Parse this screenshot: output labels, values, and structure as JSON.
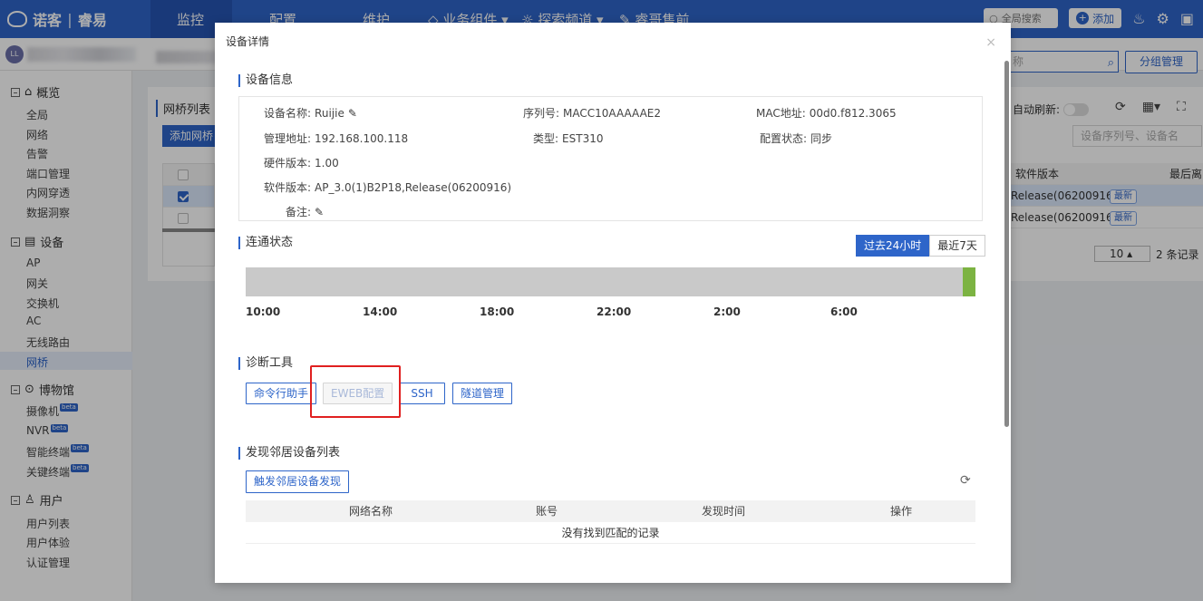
{
  "topbar": {
    "brand": "诺客",
    "brand2": "睿易",
    "nav": [
      "监控",
      "配置",
      "维护",
      "业务组件 ▾",
      "探索频道 ▾",
      "睿哥售前"
    ],
    "search_label": "全局搜索",
    "add_label": "添加"
  },
  "subbar": {
    "avatar_text": "LL"
  },
  "sidebar": {
    "groups": [
      {
        "label": "概览",
        "items": [
          "全局",
          "网络",
          "告警",
          "端口管理",
          "内网穿透",
          "数据洞察"
        ]
      },
      {
        "label": "设备",
        "items": [
          "AP",
          "网关",
          "交换机",
          "AC",
          "无线路由",
          "网桥"
        ]
      },
      {
        "label": "博物馆",
        "items": [
          "摄像机",
          "NVR",
          "智能终端",
          "关键终端"
        ]
      },
      {
        "label": "用户",
        "items": [
          "用户列表",
          "用户体验",
          "认证管理"
        ]
      }
    ],
    "beta": "beta",
    "active_item": "网桥"
  },
  "main": {
    "panel_title": "网桥列表",
    "add_button": "添加网桥",
    "search_placeholder": "称",
    "group_manage": "分组管理",
    "auto_refresh": "自动刷新:",
    "device_search_placeholder": "设备序列号、设备名",
    "col_software": "软件版本",
    "col_last": "最后离",
    "rows": [
      {
        "software": "Release(06200916)",
        "tag": "最新"
      },
      {
        "software": "Release(06200916)",
        "tag": "最新"
      }
    ],
    "page_size": "10",
    "record_count": "2 条记录"
  },
  "modal": {
    "title": "设备详情",
    "close": "×",
    "device_info": {
      "section": "设备信息",
      "name_label": "设备名称:",
      "name_value": "Ruijie",
      "serial_label": "序列号:",
      "serial_value": "MACC10AAAAAE2",
      "mac_label": "MAC地址:",
      "mac_value": "00d0.f812.3065",
      "mgmt_label": "管理地址:",
      "mgmt_value": "192.168.100.118",
      "type_label": "类型:",
      "type_value": "EST310",
      "cfg_label": "配置状态:",
      "cfg_value": "同步",
      "hw_label": "硬件版本:",
      "hw_value": "1.00",
      "sw_label": "软件版本:",
      "sw_value": "AP_3.0(1)B2P18,Release(06200916)",
      "note_label": "备注:"
    },
    "connectivity": {
      "section": "连通状态",
      "tab_24h": "过去24小时",
      "tab_7d": "最近7天",
      "ticks": [
        "10:00",
        "14:00",
        "18:00",
        "22:00",
        "2:00",
        "6:00"
      ]
    },
    "diagnostics": {
      "section": "诊断工具",
      "buttons": [
        "命令行助手",
        "EWEB配置",
        "SSH",
        "隧道管理"
      ]
    },
    "neighbors": {
      "section": "发现邻居设备列表",
      "trigger": "触发邻居设备发现",
      "columns": [
        "网络名称",
        "账号",
        "发现时间",
        "操作"
      ],
      "empty": "没有找到匹配的记录"
    }
  },
  "colors": {
    "primary": "#2e65c9",
    "online": "#7cb342",
    "highlight": "#e02020"
  }
}
